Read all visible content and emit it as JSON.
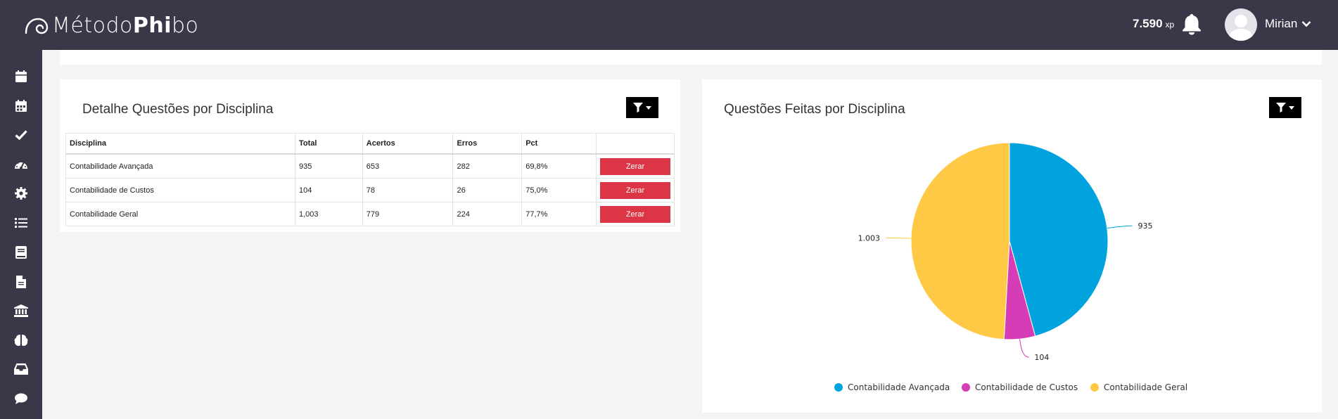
{
  "header": {
    "brand_part1": "Método ",
    "brand_part2": "Phi",
    "brand_part3": "bo",
    "xp_value": "7.590",
    "xp_unit": "xp",
    "username": "Mirian"
  },
  "sidebar": {
    "icons": [
      "calendar-icon",
      "calendar-grid-icon",
      "check-icon",
      "dashboard-gauge-icon",
      "gear-icon",
      "list-ordered-icon",
      "book-icon",
      "file-icon",
      "bank-icon",
      "brain-icon",
      "inbox-icon",
      "comment-icon"
    ]
  },
  "detail_card": {
    "title": "Detalhe Questões por Disciplina",
    "columns": [
      "Disciplina",
      "Total",
      "Acertos",
      "Erros",
      "Pct",
      ""
    ],
    "rows": [
      {
        "disciplina": "Contabilidade Avançada",
        "total": "935",
        "acertos": "653",
        "erros": "282",
        "pct": "69,8%",
        "action": "Zerar"
      },
      {
        "disciplina": "Contabilidade de Custos",
        "total": "104",
        "acertos": "78",
        "erros": "26",
        "pct": "75,0%",
        "action": "Zerar"
      },
      {
        "disciplina": "Contabilidade Geral",
        "total": "1,003",
        "acertos": "779",
        "erros": "224",
        "pct": "77,7%",
        "action": "Zerar"
      }
    ]
  },
  "chart_card": {
    "title": "Questões Feitas por Disciplina"
  },
  "chart_data": {
    "type": "pie",
    "categories": [
      "Contabilidade Avançada",
      "Contabilidade de Custos",
      "Contabilidade Geral"
    ],
    "values": [
      935,
      104,
      1003
    ],
    "data_labels": [
      "935",
      "104",
      "1.003"
    ],
    "colors": [
      "#00a3de",
      "#d63cb6",
      "#ffc845"
    ],
    "legend_position": "bottom"
  },
  "colors": {
    "topbar": "#393848",
    "danger": "#dc3545"
  }
}
